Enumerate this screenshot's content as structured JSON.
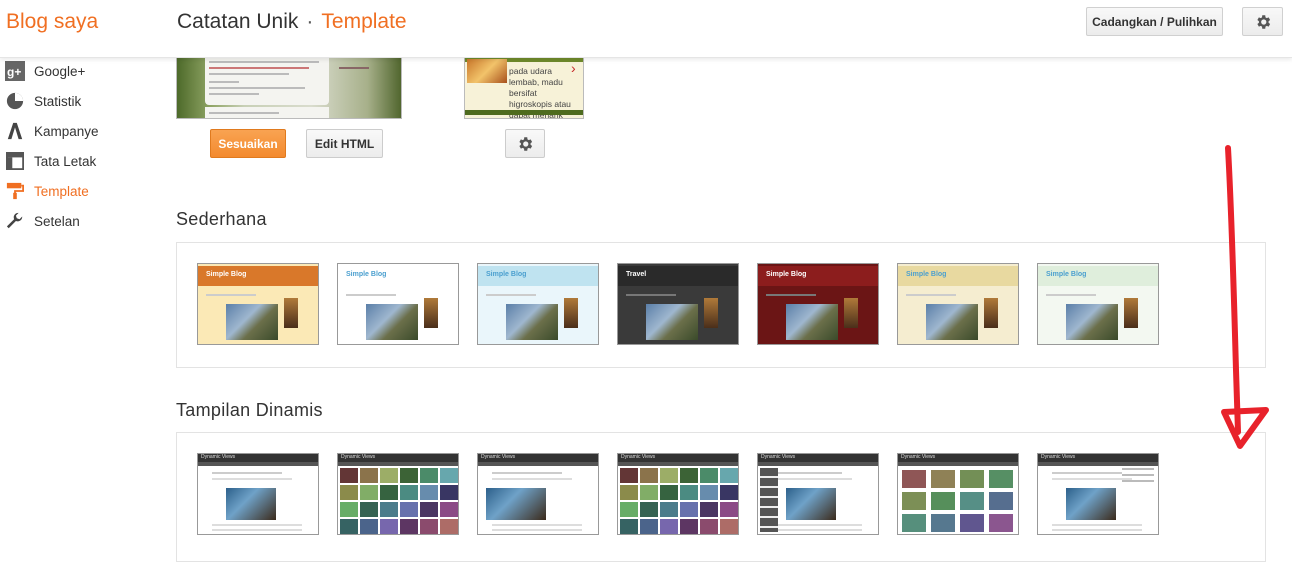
{
  "header": {
    "brand": "Blog saya",
    "breadcrumb_blog": "Catatan Unik",
    "breadcrumb_sep": "·",
    "breadcrumb_page": "Template",
    "backup_label": "Cadangkan / Pulihkan",
    "settings_icon": "gear-icon"
  },
  "sidebar": {
    "items": [
      {
        "label": "Google+",
        "icon": "google-plus-icon"
      },
      {
        "label": "Statistik",
        "icon": "pie-chart-icon"
      },
      {
        "label": "Kampanye",
        "icon": "adwords-icon"
      },
      {
        "label": "Tata Letak",
        "icon": "layout-icon"
      },
      {
        "label": "Template",
        "icon": "paint-roller-icon",
        "active": true
      },
      {
        "label": "Setelan",
        "icon": "wrench-icon"
      }
    ]
  },
  "current": {
    "customize_label": "Sesuaikan",
    "edit_html_label": "Edit HTML",
    "mobile_caption": "pada udara lembab, madu bersifat higroskopis atau dapat menarik air...",
    "mobile_gear_icon": "gear-icon"
  },
  "sections": {
    "simple_title": "Sederhana",
    "dynamic_title": "Tampilan Dinamis"
  },
  "simple_templates": [
    {
      "title": "Simple Blog",
      "header_color": "#d9782a",
      "bg": "#fbe9b6"
    },
    {
      "title": "Simple Blog",
      "header_color": "#ffffff",
      "bg": "#ffffff"
    },
    {
      "title": "Simple Blog",
      "header_color": "#bfe3f0",
      "bg": "#eaf6fb"
    },
    {
      "title": "Travel",
      "header_color": "#2a2a2a",
      "bg": "#3a3a3a"
    },
    {
      "title": "Simple Blog",
      "header_color": "#8c1d1d",
      "bg": "#6b1515"
    },
    {
      "title": "Simple Blog",
      "header_color": "#e8d9a0",
      "bg": "#f5edd0"
    },
    {
      "title": "Simple Blog",
      "header_color": "#dfeedc",
      "bg": "#f3f8f1"
    }
  ],
  "dynamic_templates": [
    {
      "label": "Dynamic Views"
    },
    {
      "label": "Dynamic Views"
    },
    {
      "label": "Dynamic Views"
    },
    {
      "label": "Dynamic Views"
    },
    {
      "label": "Dynamic Views"
    },
    {
      "label": "Dynamic Views"
    },
    {
      "label": "Dynamic Views"
    }
  ],
  "colors": {
    "accent": "#f06f22",
    "annotation": "#e8222b"
  }
}
